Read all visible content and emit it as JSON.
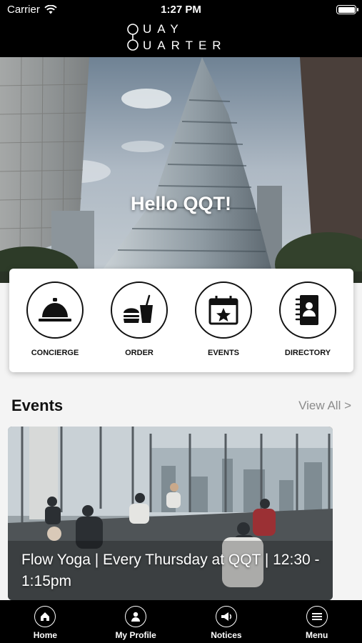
{
  "status_bar": {
    "carrier": "Carrier",
    "time": "1:27 PM"
  },
  "brand": {
    "line1": "UAY",
    "line2": "UARTER"
  },
  "hero": {
    "greeting": "Hello QQT!"
  },
  "quick_actions": [
    {
      "label": "CONCIERGE",
      "icon": "concierge-bell-icon"
    },
    {
      "label": "ORDER",
      "icon": "food-drink-icon"
    },
    {
      "label": "EVENTS",
      "icon": "calendar-star-icon"
    },
    {
      "label": "DIRECTORY",
      "icon": "directory-book-icon"
    }
  ],
  "events": {
    "heading": "Events",
    "view_all": "View All >",
    "featured_title": "Flow Yoga | Every Thursday at QQT | 12:30 - 1:15pm"
  },
  "tabs": [
    {
      "label": "Home",
      "icon": "home-icon"
    },
    {
      "label": "My Profile",
      "icon": "profile-icon"
    },
    {
      "label": "Notices",
      "icon": "megaphone-icon"
    },
    {
      "label": "Menu",
      "icon": "hamburger-icon"
    }
  ],
  "colors": {
    "header_bg": "#000000",
    "page_bg": "#f4f4f4",
    "muted_text": "#8b8b8b"
  }
}
